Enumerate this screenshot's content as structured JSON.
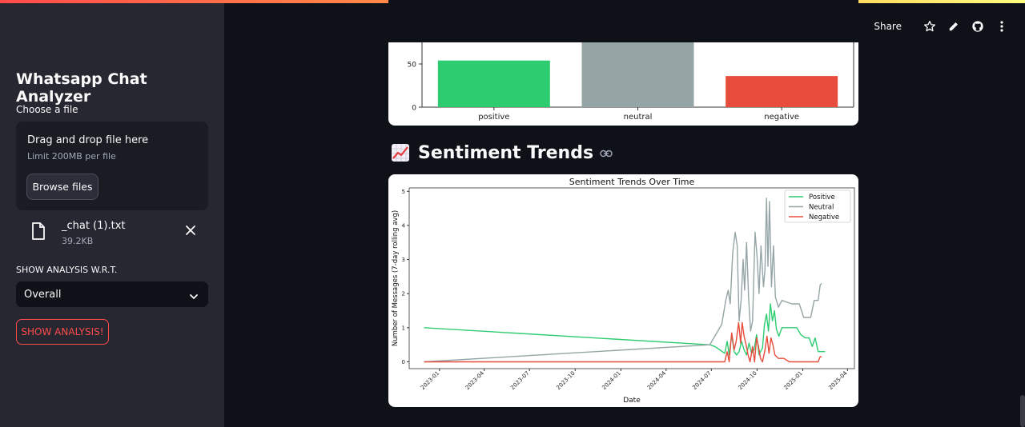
{
  "sidebar": {
    "title": "Whatsapp Chat Analyzer",
    "choose_label": "Choose a file",
    "dropzone_title": "Drag and drop file here",
    "dropzone_limit": "Limit 200MB per file",
    "browse_label": "Browse files",
    "file_name": "_chat (1).txt",
    "file_size": "39.2KB",
    "wrt_label": "SHOW ANALYSIS W.R.T.",
    "select_value": "Overall",
    "analysis_button": "SHOW ANALYSIS!"
  },
  "toolbar": {
    "share_label": "Share",
    "icons": [
      "star-icon",
      "pencil-icon",
      "github-icon",
      "more-vertical-icon"
    ]
  },
  "section": {
    "heading": "Sentiment Trends",
    "emoji": "chart-increasing-icon"
  },
  "colors": {
    "accent": "#ff4b4b",
    "positive": "#2ecc71",
    "neutral": "#95a5a6",
    "negative": "#e74c3c"
  },
  "chart_data": [
    {
      "type": "bar",
      "categories": [
        "positive",
        "neutral",
        "negative"
      ],
      "values": [
        54,
        90,
        36
      ],
      "ytick_labels": [
        "0",
        "50"
      ],
      "colors": [
        "#2ecc71",
        "#95a5a6",
        "#e74c3c"
      ]
    },
    {
      "type": "line",
      "title": "Sentiment Trends Over Time",
      "xlabel": "Date",
      "ylabel": "Number of Messages (7-day rolling avg)",
      "ylim": [
        -0.2,
        5.1
      ],
      "xlim": [
        "2022-11-01",
        "2025-04-15"
      ],
      "yticks": [
        "0",
        "1",
        "2",
        "3",
        "4",
        "5"
      ],
      "xticks": [
        "2023-01",
        "2023-04",
        "2023-07",
        "2023-10",
        "2024-01",
        "2024-04",
        "2024-07",
        "2024-10",
        "2025-01",
        "2025-04"
      ],
      "legend_position": "top-right",
      "series": [
        {
          "name": "Positive",
          "color": "#2ecc71",
          "points": [
            [
              "2022-12-01",
              1.0
            ],
            [
              "2024-06-28",
              0.5
            ],
            [
              "2024-07-08",
              0.45
            ],
            [
              "2024-07-18",
              0.35
            ],
            [
              "2024-07-28",
              0.25
            ],
            [
              "2024-08-02",
              0.6
            ],
            [
              "2024-08-06",
              0.2
            ],
            [
              "2024-08-11",
              0.8
            ],
            [
              "2024-08-16",
              0.3
            ],
            [
              "2024-08-21",
              0.2
            ],
            [
              "2024-08-26",
              0.3
            ],
            [
              "2024-08-31",
              0.6
            ],
            [
              "2024-09-05",
              0.35
            ],
            [
              "2024-09-10",
              0.2
            ],
            [
              "2024-09-15",
              0.55
            ],
            [
              "2024-09-20",
              0.25
            ],
            [
              "2024-09-25",
              0.35
            ],
            [
              "2024-09-30",
              0.8
            ],
            [
              "2024-10-05",
              0.2
            ],
            [
              "2024-10-08",
              0.3
            ],
            [
              "2024-10-12",
              0.4
            ],
            [
              "2024-10-16",
              1.1
            ],
            [
              "2024-10-20",
              1.4
            ],
            [
              "2024-10-24",
              0.9
            ],
            [
              "2024-10-28",
              1.7
            ],
            [
              "2024-11-01",
              1.2
            ],
            [
              "2024-11-05",
              1.5
            ],
            [
              "2024-11-09",
              0.95
            ],
            [
              "2024-11-14",
              0.75
            ],
            [
              "2024-11-20",
              1.0
            ],
            [
              "2024-12-01",
              1.0
            ],
            [
              "2024-12-20",
              1.0
            ],
            [
              "2024-12-28",
              0.8
            ],
            [
              "2025-01-06",
              0.7
            ],
            [
              "2025-01-14",
              0.7
            ],
            [
              "2025-01-20",
              0.45
            ],
            [
              "2025-01-26",
              0.7
            ],
            [
              "2025-02-01",
              0.3
            ],
            [
              "2025-02-15",
              0.3
            ]
          ]
        },
        {
          "name": "Neutral",
          "color": "#95a5a6",
          "points": [
            [
              "2022-12-01",
              0.0
            ],
            [
              "2024-06-28",
              0.5
            ],
            [
              "2024-07-10",
              0.8
            ],
            [
              "2024-07-22",
              1.1
            ],
            [
              "2024-07-30",
              1.8
            ],
            [
              "2024-08-04",
              2.1
            ],
            [
              "2024-08-08",
              1.7
            ],
            [
              "2024-08-13",
              3.2
            ],
            [
              "2024-08-18",
              3.8
            ],
            [
              "2024-08-22",
              3.4
            ],
            [
              "2024-08-26",
              1.2
            ],
            [
              "2024-08-30",
              1.8
            ],
            [
              "2024-09-03",
              3.0
            ],
            [
              "2024-09-06",
              2.1
            ],
            [
              "2024-09-10",
              3.5
            ],
            [
              "2024-09-14",
              1.9
            ],
            [
              "2024-09-18",
              0.9
            ],
            [
              "2024-09-22",
              1.2
            ],
            [
              "2024-09-27",
              3.8
            ],
            [
              "2024-10-01",
              3.1
            ],
            [
              "2024-10-05",
              2.0
            ],
            [
              "2024-10-09",
              3.4
            ],
            [
              "2024-10-14",
              2.2
            ],
            [
              "2024-10-17",
              2.7
            ],
            [
              "2024-10-20",
              4.8
            ],
            [
              "2024-10-23",
              2.8
            ],
            [
              "2024-10-26",
              4.7
            ],
            [
              "2024-10-30",
              2.2
            ],
            [
              "2024-11-03",
              3.4
            ],
            [
              "2024-11-07",
              1.9
            ],
            [
              "2024-11-13",
              1.6
            ],
            [
              "2024-11-20",
              1.8
            ],
            [
              "2024-12-10",
              1.7
            ],
            [
              "2024-12-25",
              1.7
            ],
            [
              "2025-01-03",
              1.3
            ],
            [
              "2025-01-17",
              1.3
            ],
            [
              "2025-01-24",
              1.8
            ],
            [
              "2025-02-01",
              1.8
            ],
            [
              "2025-02-05",
              2.25
            ],
            [
              "2025-02-08",
              2.3
            ]
          ]
        },
        {
          "name": "Negative",
          "color": "#e74c3c",
          "points": [
            [
              "2022-12-01",
              0.0
            ],
            [
              "2024-07-28",
              0.0
            ],
            [
              "2024-08-02",
              0.3
            ],
            [
              "2024-08-06",
              0.0
            ],
            [
              "2024-08-11",
              0.85
            ],
            [
              "2024-08-16",
              0.35
            ],
            [
              "2024-08-20",
              0.6
            ],
            [
              "2024-08-25",
              1.15
            ],
            [
              "2024-08-29",
              0.55
            ],
            [
              "2024-09-01",
              1.15
            ],
            [
              "2024-09-05",
              0.75
            ],
            [
              "2024-09-09",
              0.5
            ],
            [
              "2024-09-13",
              0.2
            ],
            [
              "2024-09-17",
              0.0
            ],
            [
              "2024-09-22",
              0.45
            ],
            [
              "2024-09-26",
              0.0
            ],
            [
              "2024-09-30",
              0.7
            ],
            [
              "2024-10-04",
              0.45
            ],
            [
              "2024-10-08",
              0.1
            ],
            [
              "2024-10-12",
              0.0
            ],
            [
              "2024-10-17",
              0.35
            ],
            [
              "2024-10-21",
              0.75
            ],
            [
              "2024-10-25",
              0.25
            ],
            [
              "2024-10-29",
              0.7
            ],
            [
              "2024-11-02",
              0.5
            ],
            [
              "2024-11-06",
              0.2
            ],
            [
              "2024-11-13",
              0.1
            ],
            [
              "2024-11-24",
              0.1
            ],
            [
              "2024-12-05",
              0.0
            ],
            [
              "2025-02-01",
              0.0
            ],
            [
              "2025-02-05",
              0.15
            ],
            [
              "2025-02-08",
              0.15
            ]
          ]
        }
      ]
    }
  ]
}
